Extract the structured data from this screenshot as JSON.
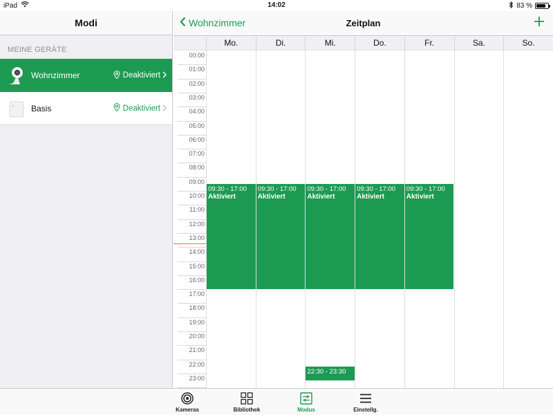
{
  "status": {
    "device": "iPad",
    "time": "14:02",
    "battery": "83 %",
    "battery_level": 0.83
  },
  "sidebar": {
    "title": "Modi",
    "section": "MEINE GERÄTE",
    "devices": [
      {
        "name": "Wohnzimmer",
        "status": "Deaktiviert",
        "active": true,
        "icon": "camera-icon"
      },
      {
        "name": "Basis",
        "status": "Deaktiviert",
        "active": false,
        "icon": "base-station-icon"
      }
    ]
  },
  "schedule": {
    "back_label": "Wohnzimmer",
    "title": "Zeitplan",
    "add_icon": "plus-icon",
    "days": [
      "Mo.",
      "Di.",
      "Mi.",
      "Do.",
      "Fr.",
      "Sa.",
      "So."
    ],
    "hours": [
      "00:00",
      "01:00",
      "02:00",
      "03:00",
      "04:00",
      "05:00",
      "06:00",
      "07:00",
      "08:00",
      "09:00",
      "10:00",
      "11:00",
      "12:00",
      "13:00",
      "14:00",
      "15:00",
      "16:00",
      "17:00",
      "18:00",
      "19:00",
      "20:00",
      "21:00",
      "22:00",
      "23:00"
    ],
    "events": [
      {
        "day": 0,
        "start": 9.5,
        "end": 17.0,
        "time": "09:30 - 17:00",
        "state": "Aktiviert"
      },
      {
        "day": 1,
        "start": 9.5,
        "end": 17.0,
        "time": "09:30 - 17:00",
        "state": "Aktiviert"
      },
      {
        "day": 2,
        "start": 9.5,
        "end": 17.0,
        "time": "09:30 - 17:00",
        "state": "Aktiviert"
      },
      {
        "day": 3,
        "start": 9.5,
        "end": 17.0,
        "time": "09:30 - 17:00",
        "state": "Aktiviert"
      },
      {
        "day": 4,
        "start": 9.5,
        "end": 17.0,
        "time": "09:30 - 17:00",
        "state": "Aktiviert"
      },
      {
        "day": 2,
        "start": 22.5,
        "end": 23.5,
        "time": "22:30 - 23:30",
        "state": ""
      }
    ],
    "current_time": 14.03
  },
  "tabs": [
    {
      "label": "Kameras",
      "icon": "camera-lens-icon",
      "active": false
    },
    {
      "label": "Bibliothek",
      "icon": "grid-icon",
      "active": false
    },
    {
      "label": "Modus",
      "icon": "mode-sliders-icon",
      "active": true
    },
    {
      "label": "Einstellg.",
      "icon": "menu-icon",
      "active": false
    }
  ],
  "colors": {
    "accent": "#1d9a52"
  }
}
